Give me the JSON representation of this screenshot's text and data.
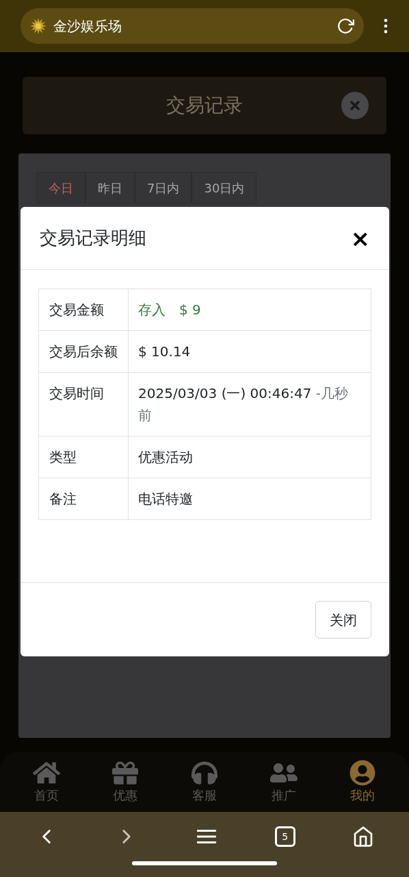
{
  "browser": {
    "site_title": "金沙娱乐场"
  },
  "page": {
    "title": "交易记录",
    "date_tabs": [
      {
        "label": "今日",
        "selected": true
      },
      {
        "label": "昨日",
        "selected": false
      },
      {
        "label": "7日内",
        "selected": false
      },
      {
        "label": "30日内",
        "selected": false
      }
    ]
  },
  "modal": {
    "title": "交易记录明细",
    "close_symbol": "×",
    "rows": [
      {
        "label": "交易金额",
        "kind": "amount",
        "value": "存入　$ 9"
      },
      {
        "label": "交易后余额",
        "kind": "text",
        "value": "$ 10.14"
      },
      {
        "label": "交易时间",
        "kind": "text",
        "value": "2025/03/03 (一) 00:46:47",
        "note": "-几秒前"
      },
      {
        "label": "类型",
        "kind": "text",
        "value": "优惠活动"
      },
      {
        "label": "备注",
        "kind": "text",
        "value": "电话特邀"
      }
    ],
    "close_button": "关闭"
  },
  "bottom_nav": [
    {
      "label": "首页",
      "selected": false
    },
    {
      "label": "优惠",
      "selected": false
    },
    {
      "label": "客服",
      "selected": false
    },
    {
      "label": "推广",
      "selected": false
    },
    {
      "label": "我的",
      "selected": true
    }
  ],
  "browser_toolbar": {
    "back_disabled": false,
    "forward_disabled": true,
    "tab_count": "5"
  }
}
